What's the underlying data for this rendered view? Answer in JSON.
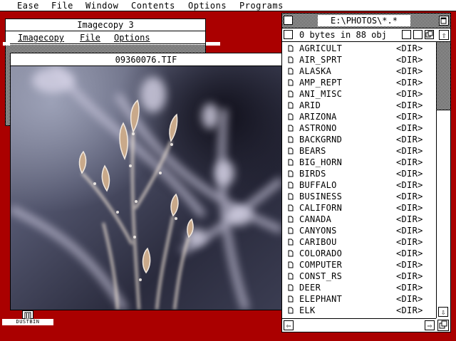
{
  "menubar": {
    "items": [
      {
        "label": "Ease"
      },
      {
        "label": "File"
      },
      {
        "label": "Window"
      },
      {
        "label": "Contents"
      },
      {
        "label": "Options"
      },
      {
        "label": "Programs"
      }
    ]
  },
  "imagecopy_window": {
    "title": "Imagecopy 3",
    "menu": [
      {
        "label": "Imagecopy"
      },
      {
        "label": "File"
      },
      {
        "label": "Options"
      }
    ]
  },
  "image_window": {
    "title": "09360076.TIF"
  },
  "desktop": {
    "dustbin_label": "DUSTBIN"
  },
  "file_window": {
    "title": "E:\\PHOTOS\\*.*",
    "info": "0 bytes in 88 obj",
    "items": [
      {
        "name": "AGRICULT",
        "type": "<DIR>"
      },
      {
        "name": "AIR_SPRT",
        "type": "<DIR>"
      },
      {
        "name": "ALASKA",
        "type": "<DIR>"
      },
      {
        "name": "AMP_REPT",
        "type": "<DIR>"
      },
      {
        "name": "ANI_MISC",
        "type": "<DIR>"
      },
      {
        "name": "ARID",
        "type": "<DIR>"
      },
      {
        "name": "ARIZONA",
        "type": "<DIR>"
      },
      {
        "name": "ASTRONO",
        "type": "<DIR>"
      },
      {
        "name": "BACKGRND",
        "type": "<DIR>"
      },
      {
        "name": "BEARS",
        "type": "<DIR>"
      },
      {
        "name": "BIG_HORN",
        "type": "<DIR>"
      },
      {
        "name": "BIRDS",
        "type": "<DIR>"
      },
      {
        "name": "BUFFALO",
        "type": "<DIR>"
      },
      {
        "name": "BUSINESS",
        "type": "<DIR>"
      },
      {
        "name": "CALIFORN",
        "type": "<DIR>"
      },
      {
        "name": "CANADA",
        "type": "<DIR>"
      },
      {
        "name": "CANYONS",
        "type": "<DIR>"
      },
      {
        "name": "CARIBOU",
        "type": "<DIR>"
      },
      {
        "name": "COLORADO",
        "type": "<DIR>"
      },
      {
        "name": "COMPUTER",
        "type": "<DIR>"
      },
      {
        "name": "CONST_RS",
        "type": "<DIR>"
      },
      {
        "name": "DEER",
        "type": "<DIR>"
      },
      {
        "name": "ELEPHANT",
        "type": "<DIR>"
      },
      {
        "name": "ELK",
        "type": "<DIR>"
      }
    ]
  },
  "colors": {
    "desktop": "#aa0000",
    "window": "#ffffff",
    "ink": "#000000"
  }
}
